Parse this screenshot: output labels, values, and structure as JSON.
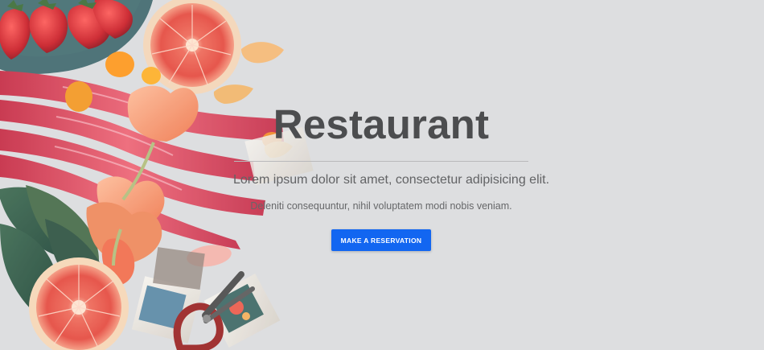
{
  "hero": {
    "title": "Restaurant",
    "subtitle": "Lorem ipsum dolor sit amet, consectetur adipisicing elit.",
    "subtext": "Deleniti consequuntur, nihil voluptatem modi nobis veniam.",
    "cta_label": "MAKE A RESERVATION"
  },
  "colors": {
    "accent": "#1266f1",
    "background": "#dcdddf",
    "title": "#4c4d4f"
  },
  "decorative_image": {
    "items": [
      "strawberry",
      "blood-orange",
      "rhubarb",
      "tulip",
      "kumquat",
      "photo-print",
      "scissors",
      "leaves"
    ]
  }
}
